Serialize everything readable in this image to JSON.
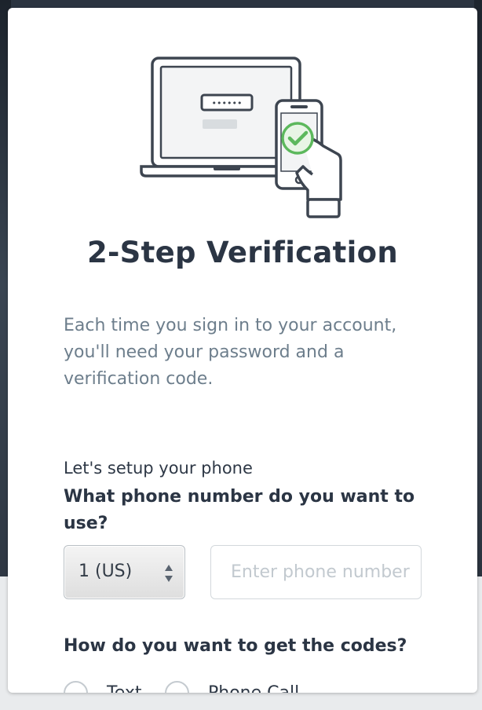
{
  "dialog": {
    "title": "2-Step Verification",
    "description": "Each time you sign in to your account, you'll need your password and a verification code.",
    "illustration": {
      "password_mask": "••••••",
      "icons": [
        "laptop-icon",
        "phone-in-hand-icon",
        "checkmark-icon"
      ]
    }
  },
  "phone_setup": {
    "label": "Let's setup your phone",
    "question": "What phone number do you want to use?",
    "country_code": "1  (US)",
    "phone_placeholder": "Enter phone number",
    "phone_value": ""
  },
  "delivery": {
    "question": "How do you want to get the codes?",
    "options": [
      {
        "label": "Text",
        "selected": false
      },
      {
        "label": "Phone Call",
        "selected": false
      }
    ]
  },
  "colors": {
    "accent_green": "#5cb85c",
    "title_text": "#2b3544",
    "muted_text": "#6d7e8c"
  }
}
